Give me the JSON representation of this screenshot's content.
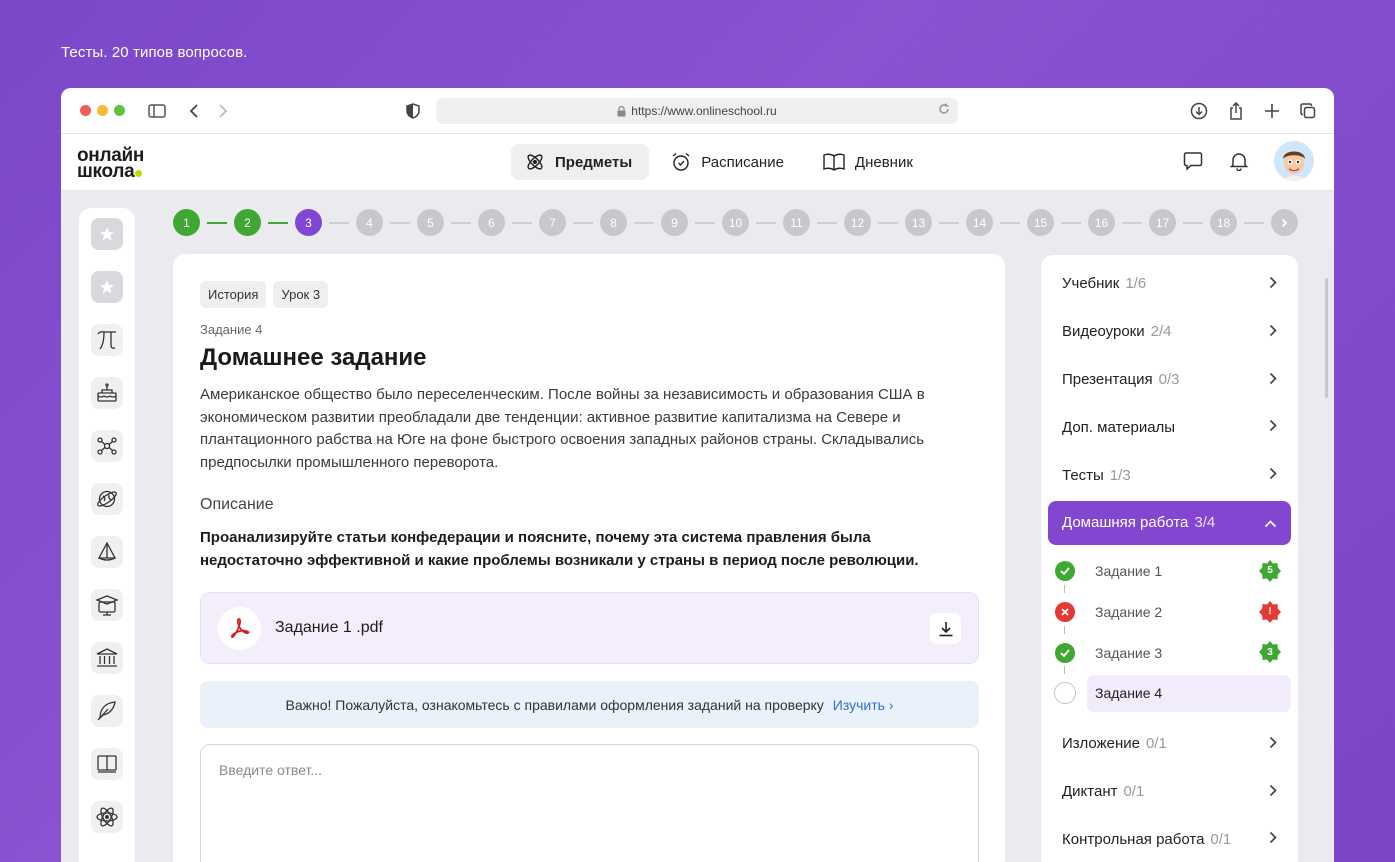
{
  "caption": "Тесты. 20 типов вопросов.",
  "browser": {
    "url": "https://www.onlineschool.ru"
  },
  "logo": {
    "line1": "онлайн",
    "line2": "школа"
  },
  "nav": [
    {
      "label": "Предметы",
      "icon": "atom-icon",
      "active": true
    },
    {
      "label": "Расписание",
      "icon": "alarm-clock-icon",
      "active": false
    },
    {
      "label": "Дневник",
      "icon": "book-open-icon",
      "active": false
    }
  ],
  "steps": [
    {
      "n": "1",
      "state": "done"
    },
    {
      "n": "2",
      "state": "done"
    },
    {
      "n": "3",
      "state": "current"
    },
    {
      "n": "4",
      "state": "todo"
    },
    {
      "n": "5",
      "state": "todo"
    },
    {
      "n": "6",
      "state": "todo"
    },
    {
      "n": "7",
      "state": "todo"
    },
    {
      "n": "8",
      "state": "todo"
    },
    {
      "n": "9",
      "state": "todo"
    },
    {
      "n": "10",
      "state": "todo"
    },
    {
      "n": "11",
      "state": "todo"
    },
    {
      "n": "12",
      "state": "todo"
    },
    {
      "n": "13",
      "state": "todo"
    },
    {
      "n": "14",
      "state": "todo"
    },
    {
      "n": "15",
      "state": "todo"
    },
    {
      "n": "16",
      "state": "todo"
    },
    {
      "n": "17",
      "state": "todo"
    },
    {
      "n": "18",
      "state": "todo"
    }
  ],
  "task": {
    "tags": [
      "История",
      "Урок 3"
    ],
    "label": "Задание 4",
    "title": "Домашнее задание",
    "text": "Американское общество было переселенческим. После войны за независимость и образования США в экономическом развитии преобладали две тенденции: активное развитие капитализма на Севере и плантационного рабства на Юге на фоне быстрого освоения западных районов страны. Складывались предпосылки промышленного переворота.",
    "description_label": "Описание",
    "description": "Проанализируйте статьи конфедерации и поясните, почему эта система правления была недостаточно эффективной и какие проблемы возникали у страны в период после революции.",
    "file_name": "Задание 1 .pdf",
    "notice_text": "Важно! Пожалуйста, ознакомьтесь с правилами оформления заданий на проверку",
    "notice_link": "Изучить ›",
    "answer_placeholder": "Введите ответ..."
  },
  "right_panel": {
    "items_top": [
      {
        "label": "Учебник",
        "count": "1/6"
      },
      {
        "label": "Видеоуроки",
        "count": "2/4"
      },
      {
        "label": "Презентация",
        "count": "0/3"
      },
      {
        "label": "Доп. материалы",
        "count": ""
      },
      {
        "label": "Тесты",
        "count": "1/3"
      }
    ],
    "open_item": {
      "label": "Домашняя работа",
      "count": "3/4"
    },
    "subtasks": [
      {
        "label": "Задание 1",
        "status": "ok",
        "badge": "5",
        "badge_color": "#3fa833"
      },
      {
        "label": "Задание 2",
        "status": "fail",
        "badge": "!",
        "badge_color": "#e53935"
      },
      {
        "label": "Задание 3",
        "status": "ok",
        "badge": "3",
        "badge_color": "#3fa833"
      },
      {
        "label": "Задание 4",
        "status": "empty",
        "badge": "",
        "badge_color": ""
      }
    ],
    "items_bottom": [
      {
        "label": "Изложение",
        "count": "0/1"
      },
      {
        "label": "Диктант",
        "count": "0/1"
      },
      {
        "label": "Контрольная работа",
        "count": "0/1"
      }
    ]
  },
  "sidebar_icons": [
    "star-icon",
    "star-icon",
    "pi-icon",
    "cake-icon",
    "molecule-icon",
    "globe-icon",
    "sail-icon",
    "graduation-icon",
    "museum-icon",
    "feather-icon",
    "book-icon",
    "atom-icon"
  ]
}
